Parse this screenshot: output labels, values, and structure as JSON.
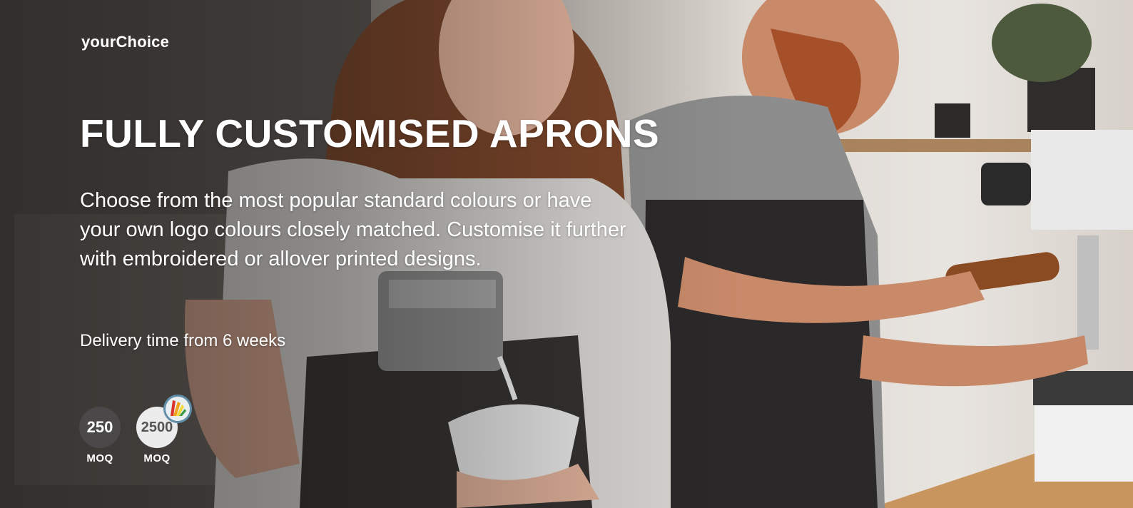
{
  "brand": "yourChoice",
  "headline": "FULLY CUSTOMISED APRONS",
  "body_text": "Choose from the most popular standard colours or have your own logo colours closely matched. Customise it further with embroidered or allover printed designs.",
  "delivery": "Delivery time from 6 weeks",
  "moq": [
    {
      "value": "250",
      "label": "MOQ"
    },
    {
      "value": "2500",
      "label": "MOQ",
      "badge_icon": "colour-swatch-icon"
    }
  ],
  "colors": {
    "text": "#ffffff",
    "moq_dark": "#4a4848",
    "moq_light": "#ececec"
  }
}
